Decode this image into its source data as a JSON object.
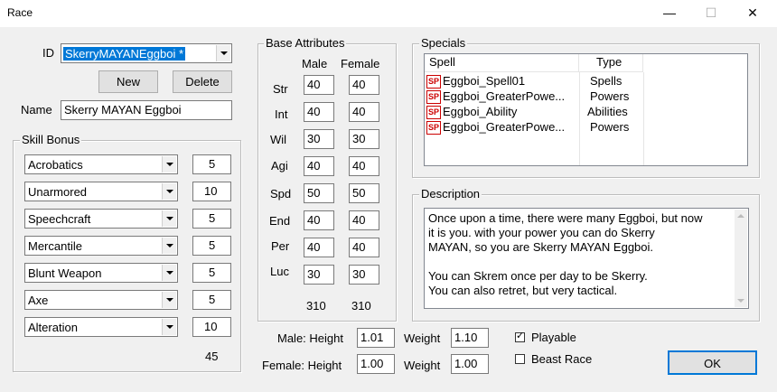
{
  "window": {
    "title": "Race",
    "minimize": "—",
    "maximize": "☐",
    "close": "✕"
  },
  "id": {
    "label": "ID",
    "value": "SkerryMAYANEggboi *"
  },
  "buttons": {
    "new": "New",
    "delete": "Delete",
    "ok": "OK"
  },
  "name": {
    "label": "Name",
    "value": "Skerry MAYAN Eggboi"
  },
  "skill_bonus": {
    "title": "Skill Bonus",
    "rows": [
      {
        "skill": "Acrobatics",
        "value": "5"
      },
      {
        "skill": "Unarmored",
        "value": "10"
      },
      {
        "skill": "Speechcraft",
        "value": "5"
      },
      {
        "skill": "Mercantile",
        "value": "5"
      },
      {
        "skill": "Blunt Weapon",
        "value": "5"
      },
      {
        "skill": "Axe",
        "value": "5"
      },
      {
        "skill": "Alteration",
        "value": "10"
      }
    ],
    "total": "45"
  },
  "base_attributes": {
    "title": "Base Attributes",
    "male_header": "Male",
    "female_header": "Female",
    "rows": [
      {
        "label": "Str",
        "male": "40",
        "female": "40"
      },
      {
        "label": "Int",
        "male": "40",
        "female": "40"
      },
      {
        "label": "Wil",
        "male": "30",
        "female": "30"
      },
      {
        "label": "Agi",
        "male": "40",
        "female": "40"
      },
      {
        "label": "Spd",
        "male": "50",
        "female": "50"
      },
      {
        "label": "End",
        "male": "40",
        "female": "40"
      },
      {
        "label": "Per",
        "male": "40",
        "female": "40"
      },
      {
        "label": "Luc",
        "male": "30",
        "female": "30"
      }
    ],
    "male_total": "310",
    "female_total": "310"
  },
  "specials": {
    "title": "Specials",
    "col_spell": "Spell",
    "col_type": "Type",
    "icon_text": "SP",
    "rows": [
      {
        "spell": "Eggboi_Spell01",
        "type": "Spells"
      },
      {
        "spell": "Eggboi_GreaterPowe...",
        "type": "Powers"
      },
      {
        "spell": "Eggboi_Ability",
        "type": "Abilities"
      },
      {
        "spell": "Eggboi_GreaterPowe...",
        "type": "Powers"
      }
    ]
  },
  "description": {
    "title": "Description",
    "lines": [
      "Once upon a time, there were many Eggboi, but now",
      "it is you. with your power you can do Skerry",
      "MAYAN, so you are Skerry MAYAN Eggboi.",
      "",
      "You can Skrem once per day to be Skerry.",
      "You can also retret, but very tactical."
    ]
  },
  "measurements": {
    "male_height_label": "Male: Height",
    "male_height": "1.01",
    "male_weight_label": "Weight",
    "male_weight": "1.10",
    "female_height_label": "Female: Height",
    "female_height": "1.00",
    "female_weight_label": "Weight",
    "female_weight": "1.00"
  },
  "flags": {
    "playable_label": "Playable",
    "playable_checked": true,
    "check_mark": "✓",
    "beast_label": "Beast Race",
    "beast_checked": false
  }
}
